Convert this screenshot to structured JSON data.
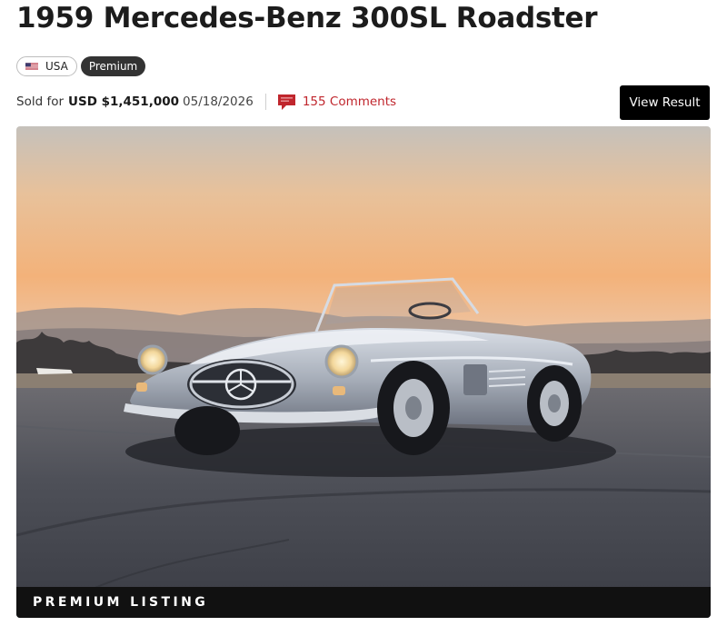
{
  "listing": {
    "title": "1959 Mercedes-Benz 300SL Roadster",
    "badges": {
      "country": "USA",
      "tier": "Premium"
    },
    "sale": {
      "label": "Sold for",
      "price": "USD $1,451,000",
      "date": "05/18/2026"
    },
    "comments": {
      "text": "155 Comments"
    },
    "view_result_label": "View Result",
    "banner_label": "PREMIUM LISTING"
  },
  "icons": {
    "flag": "us-flag-icon",
    "comments": "speech-bubble-icon"
  },
  "colors": {
    "accent": "#c0262d",
    "button_bg": "#000000",
    "premium_badge_bg": "#333333",
    "banner_bg": "#111111"
  }
}
